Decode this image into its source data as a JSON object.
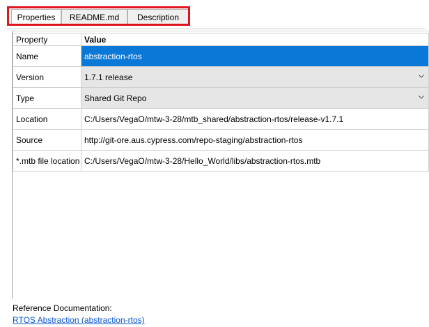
{
  "tabs": [
    {
      "label": "Properties",
      "active": true
    },
    {
      "label": "README.md",
      "active": false
    },
    {
      "label": "Description",
      "active": false
    }
  ],
  "table": {
    "headers": {
      "property": "Property",
      "value": "Value"
    },
    "rows": [
      {
        "property": "Name",
        "value": "abstraction-rtos",
        "selected": true
      },
      {
        "property": "Version",
        "value": "1.7.1 release",
        "dropdown": true
      },
      {
        "property": "Type",
        "value": "Shared Git Repo",
        "dropdown": true
      },
      {
        "property": "Location",
        "value": "C:/Users/VegaO/mtw-3-28/mtb_shared/abstraction-rtos/release-v1.7.1"
      },
      {
        "property": "Source",
        "value": "http://git-ore.aus.cypress.com/repo-staging/abstraction-rtos"
      },
      {
        "property": "*.mtb file location",
        "value": "C:/Users/VegaO/mtw-3-28/Hello_World/libs/abstraction-rtos.mtb"
      }
    ]
  },
  "footer": {
    "label": "Reference Documentation:",
    "link": "RTOS Abstraction (abstraction-rtos)"
  },
  "colors": {
    "selection": "#0a78d7",
    "highlight_box": "#e0151f",
    "link": "#0b57d0"
  }
}
